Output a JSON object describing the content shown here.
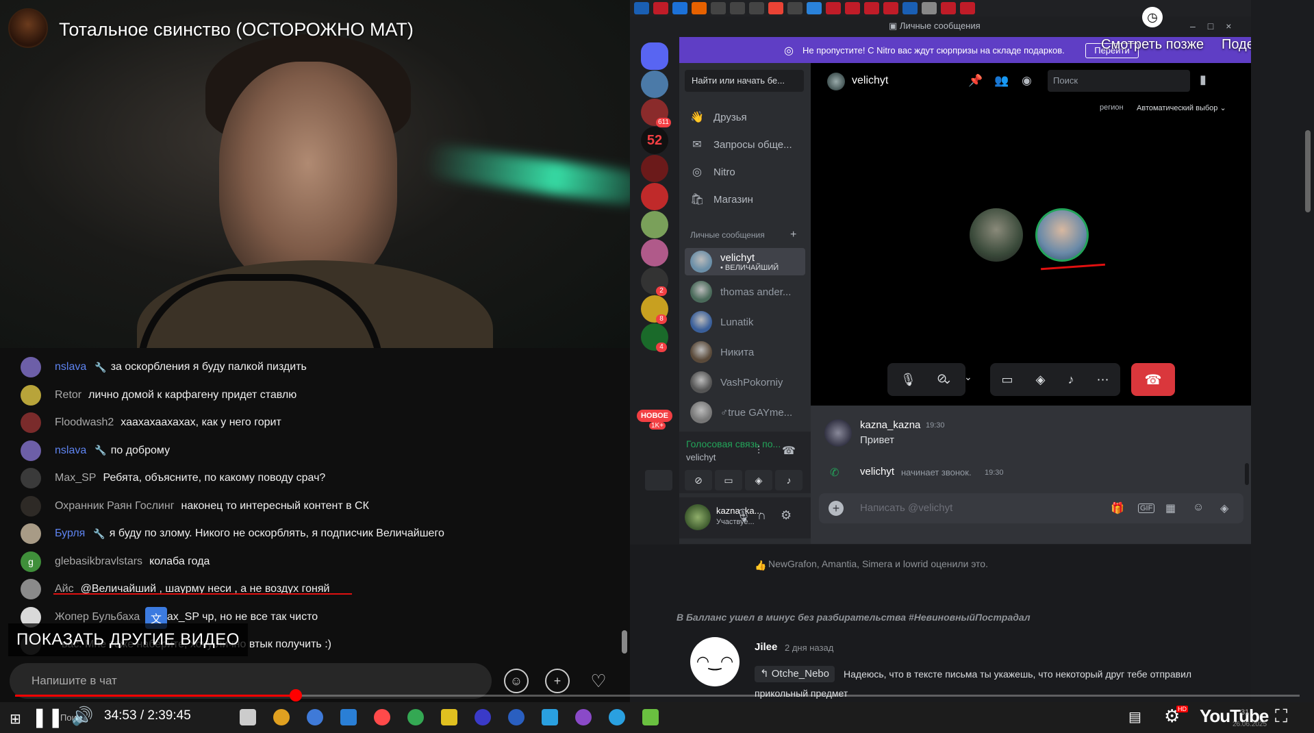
{
  "video": {
    "title": "Тотальное свинство (ОСТОРОЖНО МАТ)",
    "current_time": "34:53",
    "duration": "2:39:45",
    "time_display": "34:53 / 2:39:45",
    "progress_fraction": 0.2183,
    "other_videos_label": "ПОКАЗАТЬ ДРУГИЕ ВИДЕО",
    "logo_text": "YouTube",
    "hd_badge": "HD"
  },
  "chat": {
    "input_placeholder": "Напишите в чат",
    "messages": [
      {
        "author": "nslava",
        "mod": true,
        "text": "за оскорбления я буду палкой пиздить",
        "avatar_color": "#6d5fa8",
        "avatar_icon": "anime-avatar"
      },
      {
        "author": "Retor",
        "mod": false,
        "text": "лично домой к карфагену придет ставлю",
        "avatar_color": "#b8a43a",
        "avatar_icon": "frog-avatar"
      },
      {
        "author": "Floodwash2",
        "mod": false,
        "text": "хаахахаахахах, как у него горит",
        "avatar_color": "#7a2b2b",
        "avatar_icon": "joker-avatar"
      },
      {
        "author": "nslava",
        "mod": true,
        "text": "по доброму",
        "avatar_color": "#6d5fa8",
        "avatar_icon": "anime-avatar"
      },
      {
        "author": "Max_SP",
        "mod": false,
        "text": "Ребята, объясните, по какому поводу срач?",
        "avatar_color": "#3a3a3a",
        "avatar_icon": "mask-avatar"
      },
      {
        "author": "Охранник Раян Гослинг",
        "mod": false,
        "text": "наконец то интересный контент в СК",
        "avatar_color": "#2e2a26",
        "avatar_icon": "person-avatar"
      },
      {
        "author": "Бурля",
        "mod": true,
        "text": "я буду по злому. Никого не оскорблять, я подписчик Величайшего",
        "avatar_color": "#a89b86",
        "avatar_icon": "cat-avatar"
      },
      {
        "author": "glebasikbravlstars",
        "mod": false,
        "text": "колаба года",
        "avatar_color": "#3f8f3a",
        "avatar_icon": "letter-g-avatar",
        "avatar_letter": "g"
      },
      {
        "author": "Айс",
        "mod": false,
        "text": "@Величайший , шаурму неси , а не воздух гоняй",
        "avatar_color": "#8a8a8a",
        "avatar_icon": "person-avatar"
      },
      {
        "author": "Жопер Бульбаха",
        "mod": false,
        "text": "@Max_SP чр, но не все так чисто",
        "avatar_color": "#d9d9d9",
        "avatar_icon": "smile-avatar"
      },
      {
        "author": "",
        "mod": false,
        "text": "вас. Мне тоже наберите, хочу лично втык получить :)",
        "avatar_color": "#555555",
        "avatar_icon": "person-avatar"
      }
    ],
    "underline_color": "#e01010"
  },
  "browser": {
    "tab_colors": [
      "#1a5fb4",
      "#c01c28",
      "#1c71d8",
      "#e66100",
      "#444444",
      "#444444",
      "#444444",
      "#ea4335",
      "#444444",
      "#2a82da",
      "#c01c28",
      "#c01c28",
      "#c01c28",
      "#c01c28",
      "#1a5fb4",
      "#888888",
      "#c01c28",
      "#c01c28"
    ]
  },
  "discord": {
    "window_title": "Личные сообщения",
    "nitro_banner": "Не пропустите! С Nitro вас ждут сюрпризы на складе подарков.",
    "nitro_button": "Перейти",
    "watch_later": "Смотреть позже",
    "share": "Поделиться",
    "search_placeholder": "Найти или начать бе...",
    "nav": [
      {
        "label": "Друзья",
        "icon": "friends-icon"
      },
      {
        "label": "Запросы обще...",
        "icon": "mail-icon"
      },
      {
        "label": "Nitro",
        "icon": "nitro-icon"
      },
      {
        "label": "Магазин",
        "icon": "shop-icon"
      }
    ],
    "dm_header": "Личные сообщения",
    "dms": [
      {
        "name": "velichyt",
        "sub": "• ВЕЛИЧАЙШИЙ",
        "active": true,
        "color": "#6b8fa8"
      },
      {
        "name": "thomas ander...",
        "sub": "",
        "active": false,
        "color": "#4a6a5a"
      },
      {
        "name": "Lunatik",
        "sub": "",
        "active": false,
        "color": "#3a5f9a"
      },
      {
        "name": "Никита",
        "sub": "",
        "active": false,
        "color": "#5a4a3a"
      },
      {
        "name": "VashPokorniy",
        "sub": "",
        "active": false,
        "color": "#555555"
      },
      {
        "name": "♂true GAYme...",
        "sub": "",
        "active": false,
        "color": "#777777"
      }
    ],
    "servers": [
      {
        "color": "#5865f2",
        "badge": ""
      },
      {
        "color": "#4b7aa8",
        "badge": ""
      },
      {
        "color": "#8a2b2b",
        "badge": "611"
      },
      {
        "color": "#111111",
        "badge": "",
        "text": "52"
      },
      {
        "color": "#6b1a1a",
        "badge": ""
      },
      {
        "color": "#c02a2a",
        "badge": ""
      },
      {
        "color": "#7aa05a",
        "badge": ""
      },
      {
        "color": "#b05a8a",
        "badge": ""
      },
      {
        "color": "#333333",
        "badge": "2"
      },
      {
        "color": "#c8a020",
        "badge": "8"
      },
      {
        "color": "#1a6a2a",
        "badge": "4"
      }
    ],
    "new_badge": "НОВОЕ",
    "new_count": "1K+",
    "voice_status": "Голосовая связь по...",
    "voice_channel": "velichyt",
    "user_name": "kazna_ka...",
    "user_status": "Участвуе...",
    "call": {
      "peer_name": "velichyt",
      "search_placeholder": "Поиск",
      "region_label": "регион",
      "region_value": "Автоматический выбор"
    },
    "messages": [
      {
        "author": "kazna_kazna",
        "time": "19:30",
        "text": "Привет"
      },
      {
        "author": "velichyt",
        "text": "начинает звонок.",
        "time": "19:30"
      }
    ],
    "input_placeholder": "Написать @velichyt",
    "accent_color": "#5865f2",
    "hangup_color": "#da373c"
  },
  "background_page": {
    "likes": "NewGrafon, Amantia, Simera и lowrid оценили это.",
    "heading": "В Балланс ушел в минус без разбирательства #НевиновныйПострадал",
    "author": "Jilee",
    "time": "2 дня назад",
    "reply_to": "Otche_Nebo",
    "text_line1": "Надеюсь, что в тексте письма ты укажешь, что некоторый друг тебе отправил",
    "text_line2": "прикольный предмет"
  },
  "taskbar": {
    "search_fragment": "Поиск",
    "clock": "31",
    "date": "26.06.2025",
    "app_colors": [
      "#cccccc",
      "#e0a020",
      "#3f7ad8",
      "#2a7fd6",
      "#ff4a4a",
      "#34a853",
      "#e0c020",
      "#3a3ac8",
      "#2a5fc0",
      "#2aa0e0",
      "#8a4ac8",
      "#2aa0e0",
      "#6ac040"
    ]
  }
}
